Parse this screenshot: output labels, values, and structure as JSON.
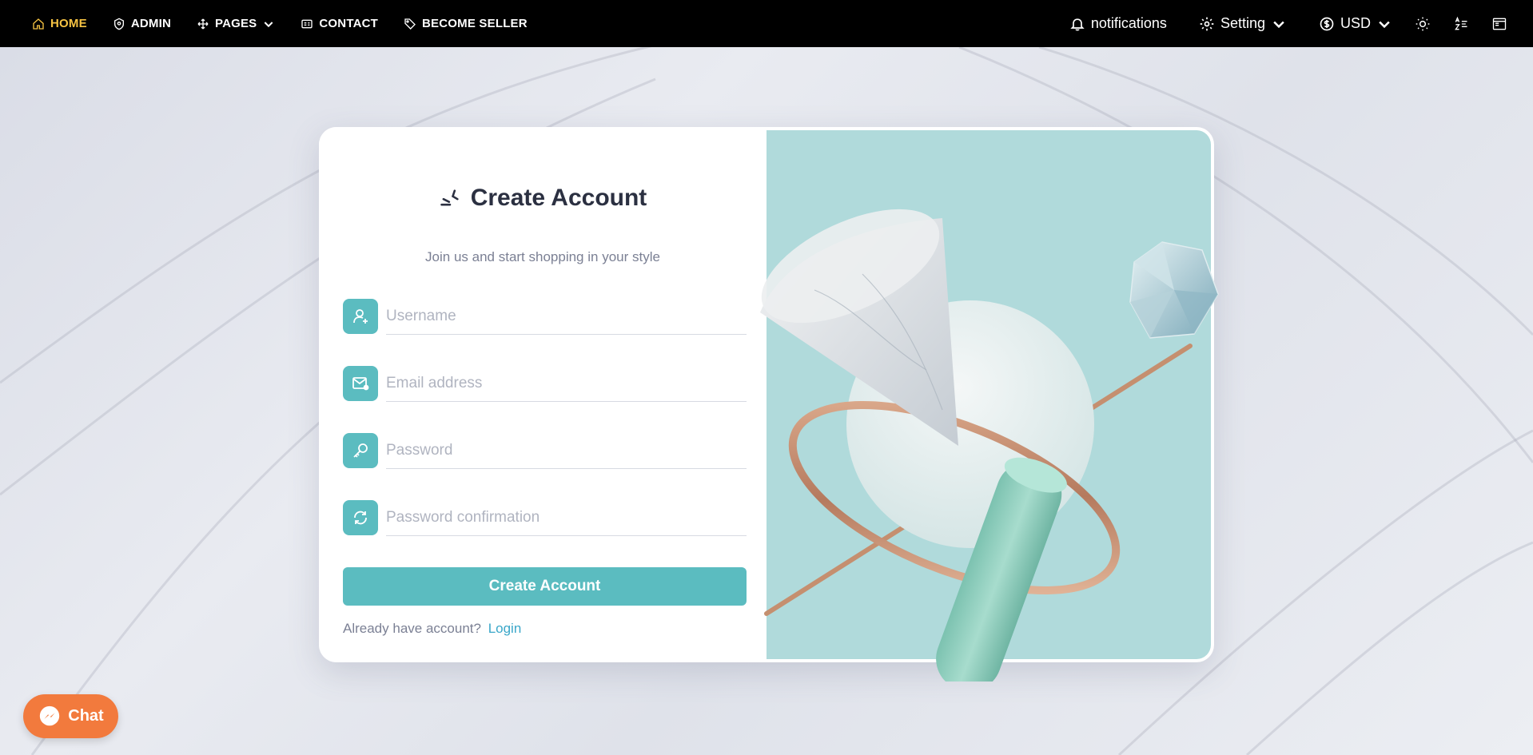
{
  "nav": {
    "left": [
      {
        "label": "HOME",
        "icon": "home-icon",
        "active": true
      },
      {
        "label": "ADMIN",
        "icon": "shield-icon"
      },
      {
        "label": "PAGES",
        "icon": "move-icon",
        "dropdown": true
      },
      {
        "label": "CONTACT",
        "icon": "contact-card-icon"
      },
      {
        "label": "BECOME SELLER",
        "icon": "tag-icon"
      }
    ],
    "right": {
      "notifications": "notifications",
      "setting": "Setting",
      "currency": "USD"
    }
  },
  "form": {
    "title": "Create Account",
    "subtitle": "Join us and start shopping in your style",
    "username_placeholder": "Username",
    "email_placeholder": "Email address",
    "password_placeholder": "Password",
    "password_confirm_placeholder": "Password confirmation",
    "submit_label": "Create Account",
    "login_prompt": "Already have account?",
    "login_link": "Login"
  },
  "chat": {
    "label": "Chat"
  },
  "colors": {
    "accent": "#5bbcc0",
    "active_nav": "#f6c343",
    "chat": "#f27a3d",
    "art_bg": "#b0dadb"
  }
}
